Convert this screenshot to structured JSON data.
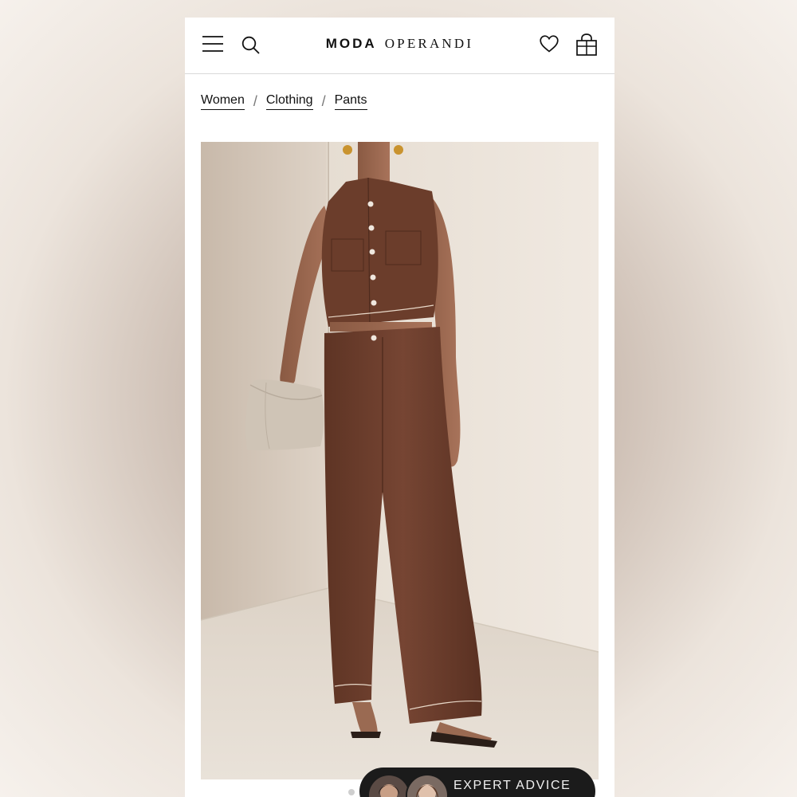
{
  "header": {
    "brand_part1": "MODA",
    "brand_part2": "OPERANDI",
    "icons": [
      "menu-icon",
      "search-icon",
      "heart-icon",
      "shopping-bag-icon"
    ]
  },
  "breadcrumb": {
    "items": [
      "Women",
      "Clothing",
      "Pants"
    ],
    "separator": "/"
  },
  "product": {
    "image": "product-photo",
    "carousel_dots": 2
  },
  "expert_advice": {
    "label": "EXPERT ADVICE"
  },
  "colors": {
    "background": "#ffffff",
    "text": "#111111",
    "expert_pill": "#1b1b1b",
    "product_brown": "#6e3f2c"
  }
}
